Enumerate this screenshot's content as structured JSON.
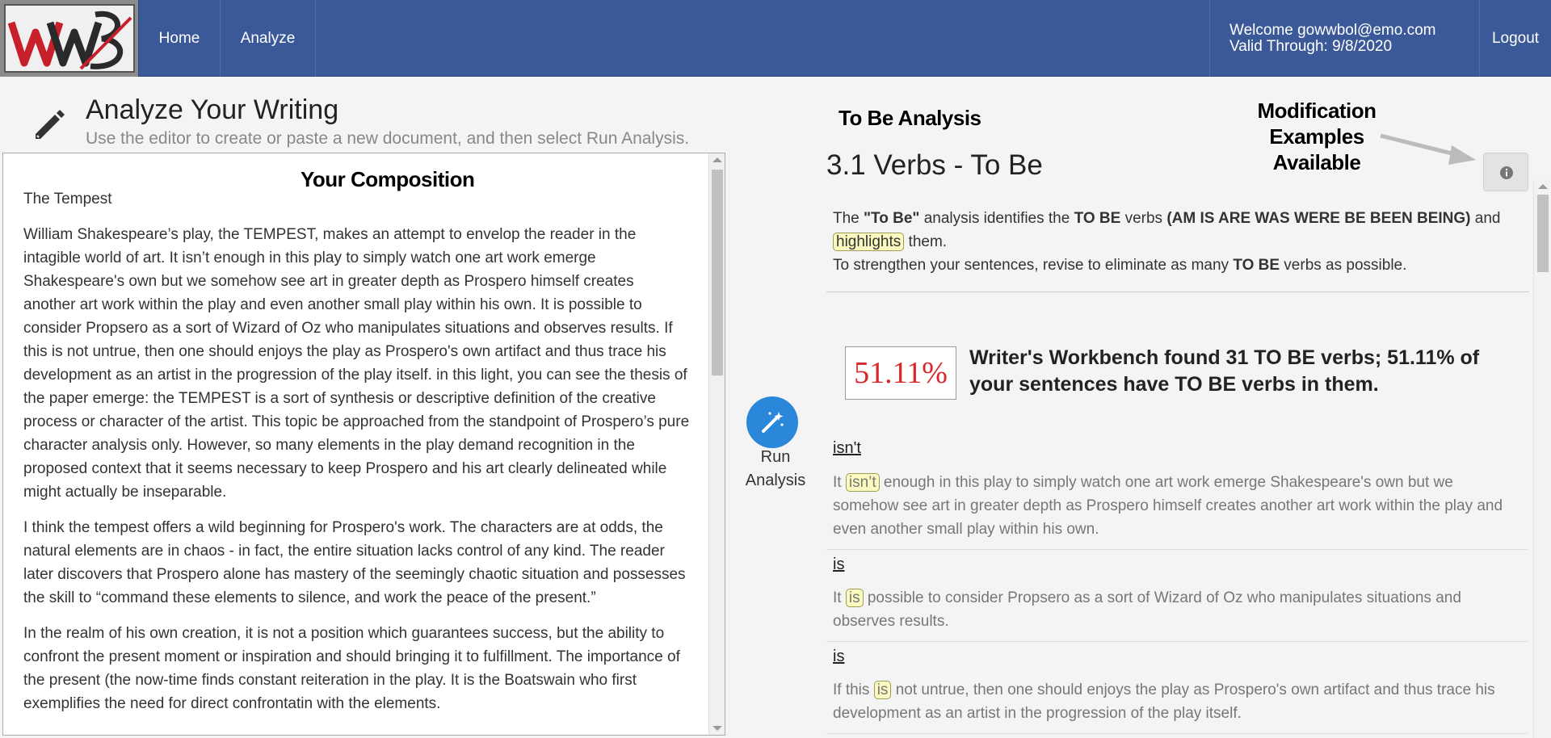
{
  "navbar": {
    "logo_text": "WWB",
    "items": [
      {
        "label": "Home"
      },
      {
        "label": "Analyze"
      }
    ],
    "user": {
      "welcome": "Welcome gowwbol@emo.com",
      "valid": "Valid Through: 9/8/2020"
    },
    "logout": "Logout",
    "colors": {
      "bar": "#3b5998",
      "text": "#ffffff"
    }
  },
  "left": {
    "icon": "pencil-icon",
    "title": "Analyze Your Writing",
    "subtitle": "Use the editor to create or paste a new document, and then select Run Analysis.",
    "annotation": "Your Composition",
    "document": {
      "title": "The Tempest",
      "paragraphs": [
        "William Shakespeare’s play, the TEMPEST, makes an attempt to envelop the reader in the intagible world of art.  It isn’t enough in this play to simply watch one art work emerge Shakespeare's own but we somehow see art in greater depth as Prospero himself creates another art work within the play and even another small play within his own.  It is possible to consider Propsero as a sort of Wizard of Oz who manipulates situations and observes results.  If this is not untrue, then one should enjoys the play as Prospero's own artifact and thus trace his development as an artist in the progression of the play itself.  in this light, you can see the thesis of the paper emerge: the TEMPEST is a sort of synthesis or descriptive definition of the creative process or character of the artist.  This topic be approached from the standpoint of Prospero’s pure character analysis only.  However, so many elements in the play demand recognition in the proposed context that it seems necessary to keep Prospero and his art clearly delineated while might actually be inseparable.",
        "I think the tempest offers a wild beginning for Prospero's work.  The characters are at odds, the natural elements are in chaos - in fact, the entire situation lacks control of any kind.  The reader later discovers that Prospero alone has mastery of the seemingly chaotic situation and possesses the skill to “command these elements to silence, and work the peace of the present.”",
        "In the realm of his own creation, it is not a position which guarantees success, but the ability to confront the present moment or inspiration and should bringing it to fulfillment.  The importance of the present (the now-time finds constant reiteration in the play. It is the Boatswain who first exemplifies the need for direct confrontatin with the elements."
      ]
    }
  },
  "run": {
    "label_line1": "Run",
    "label_line2": "Analysis",
    "icon": "magic-wand-icon",
    "color": "#2b87d9"
  },
  "right": {
    "annotation_title": "To Be Analysis",
    "annotation_mod": "Modification Examples Available",
    "title": "3.1 Verbs - To Be",
    "info_icon": "info-icon",
    "desc": {
      "p1": "The ",
      "p1_bold": "\"To Be\"",
      "p2": " analysis identifies the ",
      "p2_bold": "TO BE",
      "p3": " verbs ",
      "p3_bold": "(AM IS ARE WAS WERE BE BEEN BEING)",
      "p4": " and ",
      "highlight": "highlights",
      "p5": " them.",
      "line2_a": "To strengthen your sentences, revise to eliminate as many ",
      "line2_bold": "TO BE",
      "line2_b": " verbs as possible."
    },
    "percent": "51.11%",
    "found": "Writer's Workbench found 31 TO BE verbs; 51.11% of your sentences have TO BE verbs in them.",
    "examples": [
      {
        "word": "isn't",
        "before": "It ",
        "hl": "isn’t",
        "after": " enough in this play to simply watch one art work emerge Shakespeare's own but we somehow see art in greater depth as Prospero himself creates another art work within the play and even another small play within his own."
      },
      {
        "word": "is",
        "before": "It ",
        "hl": "is",
        "after": " possible to consider Propsero as a sort of Wizard of Oz who manipulates situations and observes results."
      },
      {
        "word": "is",
        "before": "If this ",
        "hl": "is",
        "after": " not untrue, then one should enjoys the play as Prospero's own artifact and thus trace his development as an artist in the progression of the play itself."
      }
    ],
    "colors": {
      "percent": "#d9262a",
      "highlight_bg": "#fafac0"
    }
  }
}
